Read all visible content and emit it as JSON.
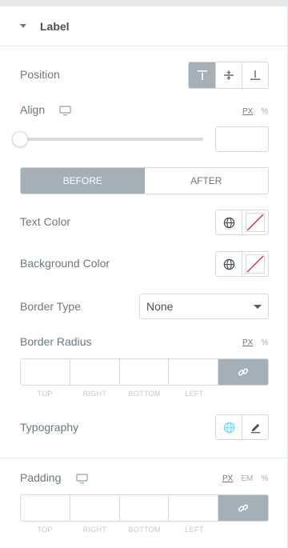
{
  "section": {
    "title": "Label"
  },
  "position": {
    "label": "Position",
    "options": [
      "top-align-icon",
      "middle-align-icon",
      "bottom-align-icon"
    ],
    "active_index": 0
  },
  "align": {
    "label": "Align",
    "units": [
      "PX",
      "%"
    ],
    "active_unit": "PX",
    "slider_value": 0,
    "value": ""
  },
  "state_tabs": {
    "items": [
      "BEFORE",
      "AFTER"
    ],
    "active_index": 0
  },
  "text_color": {
    "label": "Text Color"
  },
  "background_color": {
    "label": "Background Color"
  },
  "border_type": {
    "label": "Border Type",
    "value": "None"
  },
  "border_radius": {
    "label": "Border Radius",
    "units": [
      "PX",
      "%"
    ],
    "active_unit": "PX",
    "sides": [
      "TOP",
      "RIGHT",
      "BOTTOM",
      "LEFT"
    ]
  },
  "typography": {
    "label": "Typography"
  },
  "padding": {
    "label": "Padding",
    "units": [
      "PX",
      "EM",
      "%"
    ],
    "active_unit": "PX",
    "sides": [
      "TOP",
      "RIGHT",
      "BOTTOM",
      "LEFT"
    ]
  },
  "colors": {
    "accent": "#a4afb7",
    "globe_active": "#71d7f7",
    "no_color": "#d72b3f"
  }
}
